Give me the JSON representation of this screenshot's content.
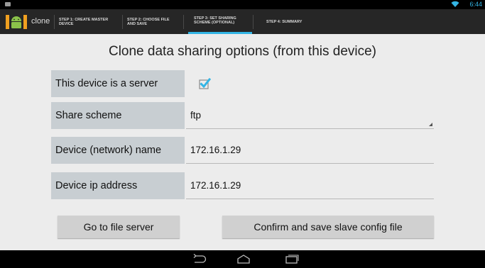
{
  "status_bar": {
    "time": "6:44",
    "left_icon": "notification-icon",
    "wifi_icon": "wifi-icon"
  },
  "action_bar": {
    "app_icon": "android-app-icon",
    "app_name": "clone",
    "tabs": [
      {
        "line1": "STEP 1: CREATE MASTER",
        "line2": "DEVICE",
        "active": false
      },
      {
        "line1": "STEP 2: CHOOSE FILE",
        "line2": "AND SAVE",
        "active": false
      },
      {
        "line1": "STEP 3: SET SHARING",
        "line2": "SCHEME (OPTIONAL)",
        "active": true
      },
      {
        "line1": "STEP 4: SUMMARY",
        "line2": "",
        "active": false
      }
    ]
  },
  "main": {
    "title": "Clone data sharing options (from this device)",
    "rows": {
      "server": {
        "label": "This device is a server",
        "checked": true
      },
      "scheme": {
        "label": "Share scheme",
        "value": "ftp"
      },
      "name": {
        "label": "Device (network) name",
        "value": "172.16.1.29"
      },
      "ip": {
        "label": "Device ip address",
        "value": "172.16.1.29"
      }
    },
    "buttons": {
      "file_server": "Go to file server",
      "confirm": "Confirm and save slave config file"
    }
  },
  "nav_bar": {
    "back_icon": "back-icon",
    "home_icon": "home-icon",
    "recents_icon": "recent-apps-icon"
  },
  "colors": {
    "accent": "#33b5e5",
    "label_bg": "#c8ced2",
    "button_bg": "#d0d0d0",
    "bars": "#000000"
  }
}
